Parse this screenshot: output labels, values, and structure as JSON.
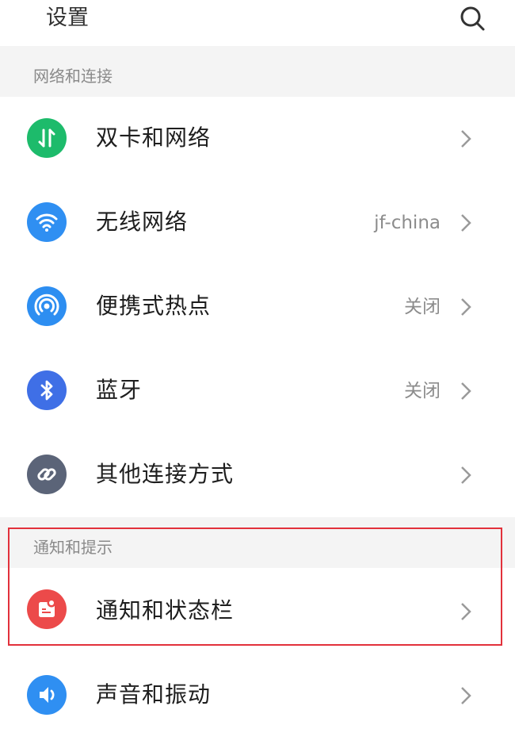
{
  "header": {
    "title": "设置",
    "search_icon": "search-icon"
  },
  "sections": [
    {
      "title": "网络和连接"
    },
    {
      "title": "通知和提示"
    }
  ],
  "rows": [
    {
      "label": "双卡和网络",
      "value": "",
      "icon": "dual-sim-icon",
      "color": "#1dbb6b"
    },
    {
      "label": "无线网络",
      "value": "jf-china",
      "icon": "wifi-icon",
      "color": "#2f8ff2"
    },
    {
      "label": "便携式热点",
      "value": "关闭",
      "icon": "hotspot-icon",
      "color": "#2d8ef1"
    },
    {
      "label": "蓝牙",
      "value": "关闭",
      "icon": "bluetooth-icon",
      "color": "#3f6fe6"
    },
    {
      "label": "其他连接方式",
      "value": "",
      "icon": "link-icon",
      "color": "#5b6478"
    },
    {
      "label": "通知和状态栏",
      "value": "",
      "icon": "notification-icon",
      "color": "#ec4a4a"
    },
    {
      "label": "声音和振动",
      "value": "",
      "icon": "sound-icon",
      "color": "#2f8ff2"
    }
  ],
  "highlight_color": "#e2313b"
}
